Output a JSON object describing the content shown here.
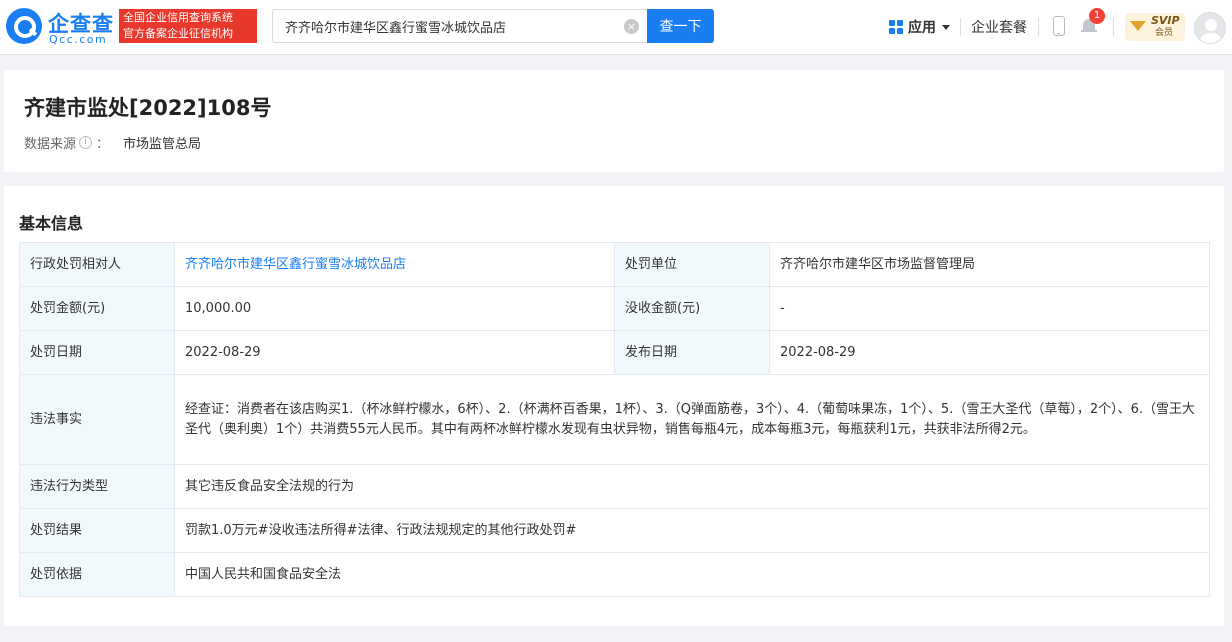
{
  "header": {
    "logo_cn": "企查查",
    "logo_en": "Qcc.com",
    "badge_line1": "全国企业信用查询系统",
    "badge_line2": "官方备案企业征信机构",
    "search_value": "齐齐哈尔市建华区鑫行蜜雪冰城饮品店",
    "search_button": "查一下",
    "apps_label": "应用",
    "package_label": "企业套餐",
    "notification_count": "1",
    "svip_label": "SVIP",
    "svip_sub": "会员"
  },
  "doc": {
    "title": "齐建市监处[2022]108号",
    "source_label": "数据来源",
    "source_colon": "：",
    "source_value": "市场监管总局"
  },
  "basic": {
    "section_title": "基本信息",
    "rows": [
      {
        "l1": "行政处罚相对人",
        "v1": "齐齐哈尔市建华区鑫行蜜雪冰城饮品店",
        "l2": "处罚单位",
        "v2": "齐齐哈尔市建华区市场监督管理局"
      },
      {
        "l1": "处罚金额(元)",
        "v1": "10,000.00",
        "l2": "没收金额(元)",
        "v2": "-"
      },
      {
        "l1": "处罚日期",
        "v1": "2022-08-29",
        "l2": "发布日期",
        "v2": "2022-08-29"
      }
    ],
    "facts_label": "违法事实",
    "facts_value": "经查证：消费者在该店购买1.（杯冰鲜柠檬水，6杯）、2.（杯满杯百香果，1杯）、3.（Q弹面筋卷，3个）、4.（葡萄味果冻，1个）、5.（雪王大圣代（草莓），2个）、6.（雪王大圣代（奥利奥）1个）共消费55元人民币。其中有两杯冰鲜柠檬水发现有虫状异物，销售每瓶4元，成本每瓶3元，每瓶获利1元，共获非法所得2元。",
    "type_label": "违法行为类型",
    "type_value": "其它违反食品安全法规的行为",
    "result_label": "处罚结果",
    "result_value": "罚款1.0万元#没收违法所得#法律、行政法规规定的其他行政处罚#",
    "basis_label": "处罚依据",
    "basis_value": "中国人民共和国食品安全法"
  },
  "colors": {
    "brand": "#1a7ef3",
    "badge_red": "#e8382c",
    "label_bg": "#f2f9fc"
  }
}
